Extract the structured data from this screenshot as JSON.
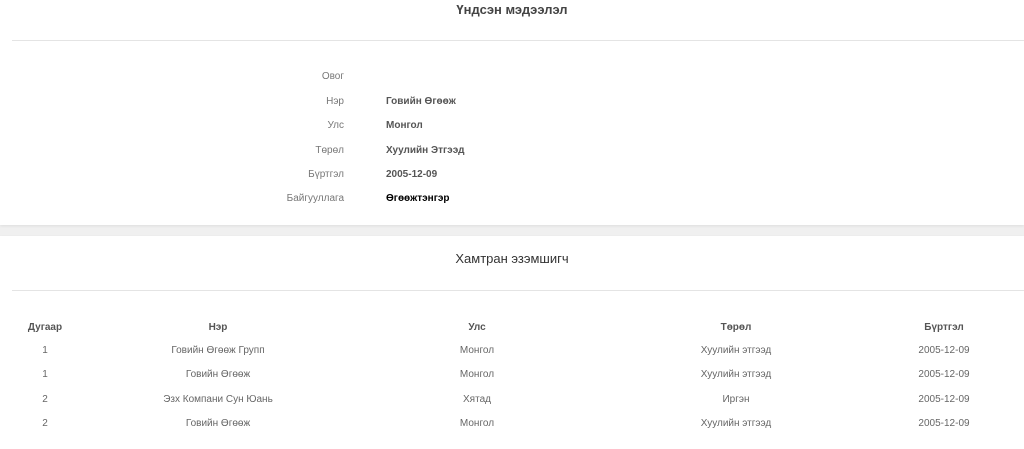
{
  "basic_info": {
    "title": "Үндсэн мэдээлэл",
    "fields": [
      {
        "label": "Овог",
        "value": ""
      },
      {
        "label": "Нэр",
        "value": "Говийн Өгөөж"
      },
      {
        "label": "Улс",
        "value": "Монгол"
      },
      {
        "label": "Төрөл",
        "value": "Хуулийн Этгээд"
      },
      {
        "label": "Бүртгэл",
        "value": "2005-12-09"
      },
      {
        "label": "Байгууллага",
        "value": "Өгөөжтэнгэр"
      }
    ]
  },
  "co_owners": {
    "title": "Хамтран эзэмшигч",
    "columns": [
      "Дугаар",
      "Нэр",
      "Улс",
      "Төрөл",
      "Бүртгэл"
    ],
    "rows": [
      {
        "number": "1",
        "name": "Говийн Өгөөж Групп",
        "country": "Монгол",
        "type": "Хуулийн этгээд",
        "registration": "2005-12-09"
      },
      {
        "number": "1",
        "name": "Говийн Өгөөж",
        "country": "Монгол",
        "type": "Хуулийн этгээд",
        "registration": "2005-12-09"
      },
      {
        "number": "2",
        "name": "Эзх Компани Сун Юань",
        "country": "Хятад",
        "type": "Иргэн",
        "registration": "2005-12-09"
      },
      {
        "number": "2",
        "name": "Говийн Өгөөж",
        "country": "Монгол",
        "type": "Хуулийн этгээд",
        "registration": "2005-12-09"
      }
    ]
  }
}
